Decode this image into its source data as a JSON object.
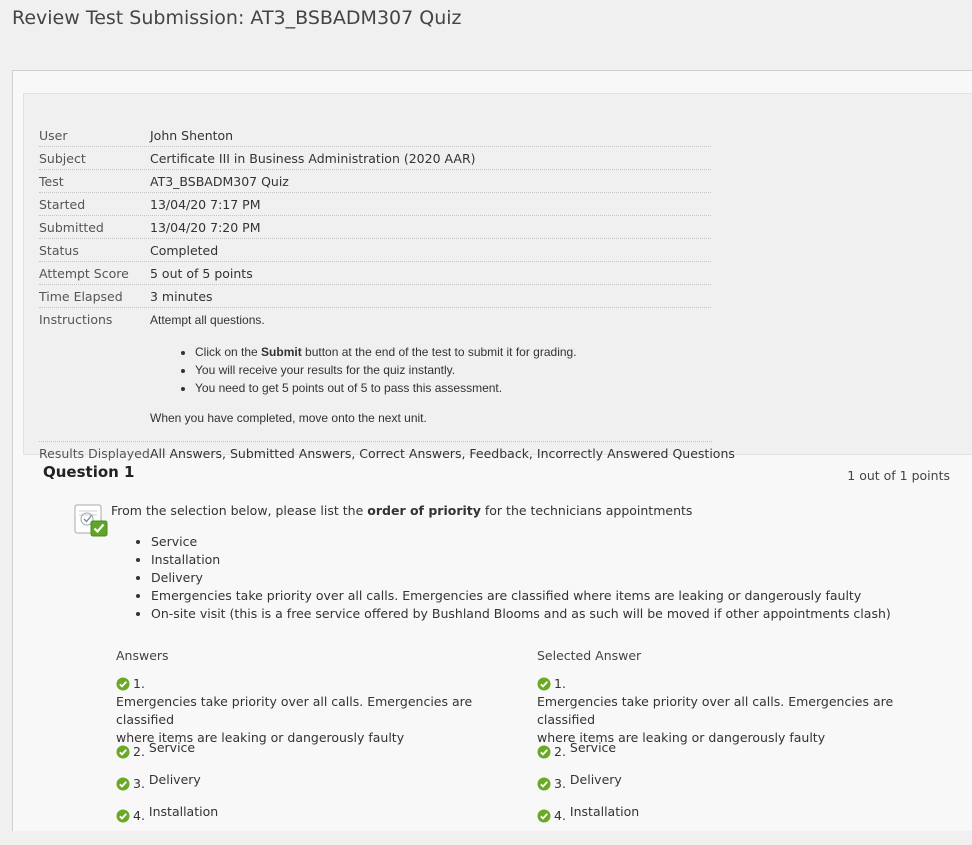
{
  "page": {
    "title": "Review Test Submission: AT3_BSBADM307 Quiz"
  },
  "details": {
    "user": {
      "label": "User",
      "value": "John Shenton"
    },
    "subject": {
      "label": "Subject",
      "value": "Certificate III in Business Administration (2020 AAR)"
    },
    "test": {
      "label": "Test",
      "value": "AT3_BSBADM307 Quiz"
    },
    "started": {
      "label": "Started",
      "value": "13/04/20 7:17 PM"
    },
    "submitted": {
      "label": "Submitted",
      "value": "13/04/20 7:20 PM"
    },
    "status": {
      "label": "Status",
      "value": "Completed"
    },
    "attempt_score": {
      "label": "Attempt Score",
      "value": "5 out of 5 points"
    },
    "time_elapsed": {
      "label": "Time Elapsed",
      "value": "3 minutes"
    },
    "instructions": {
      "label": "Instructions",
      "intro": "Attempt all questions.",
      "bullet1_pre": "Click on the ",
      "bullet1_bold": "Submit",
      "bullet1_post": " button at the end of the test to submit it for grading.",
      "bullet2": "You will receive your results for the quiz instantly.",
      "bullet3": "You need to get 5 points out of 5 to pass this assessment.",
      "outro": "When you have completed, move onto the next unit."
    },
    "results_displayed": {
      "label": "Results Displayed",
      "value": "All Answers, Submitted Answers, Correct Answers, Feedback, Incorrectly Answered Questions"
    }
  },
  "question": {
    "title": "Question 1",
    "points": "1 out of 1 points",
    "text_pre": "From the selection below, please list the ",
    "text_bold": "order of priority",
    "text_post": " for the technicians appointments",
    "options": [
      "Service",
      "Installation",
      "Delivery",
      "Emergencies take priority over all calls. Emergencies are classified where items are leaking or dangerously faulty",
      "On-site visit (this is a free service offered by Bushland Blooms and as such will be moved if other appointments clash)"
    ],
    "answers_header": "Answers",
    "selected_header": "Selected Answer",
    "answers": [
      {
        "num": "1.",
        "line1": "Emergencies take priority over all calls. Emergencies are classified",
        "line2": "where items are leaking or dangerously faulty"
      },
      {
        "num": "2.",
        "text": "Service"
      },
      {
        "num": "3.",
        "text": "Delivery"
      },
      {
        "num": "4.",
        "text": "Installation"
      }
    ],
    "selected": [
      {
        "num": "1.",
        "line1": "Emergencies take priority over all calls. Emergencies are classified",
        "line2": "where items are leaking or dangerously faulty"
      },
      {
        "num": "2.",
        "text": "Service"
      },
      {
        "num": "3.",
        "text": "Delivery"
      },
      {
        "num": "4.",
        "text": "Installation"
      }
    ]
  },
  "colors": {
    "check_green": "#6aa826",
    "background": "#f0f0f0"
  },
  "icons": {
    "question_status": "graded-correct-icon",
    "answer_mark": "correct-check-icon"
  }
}
